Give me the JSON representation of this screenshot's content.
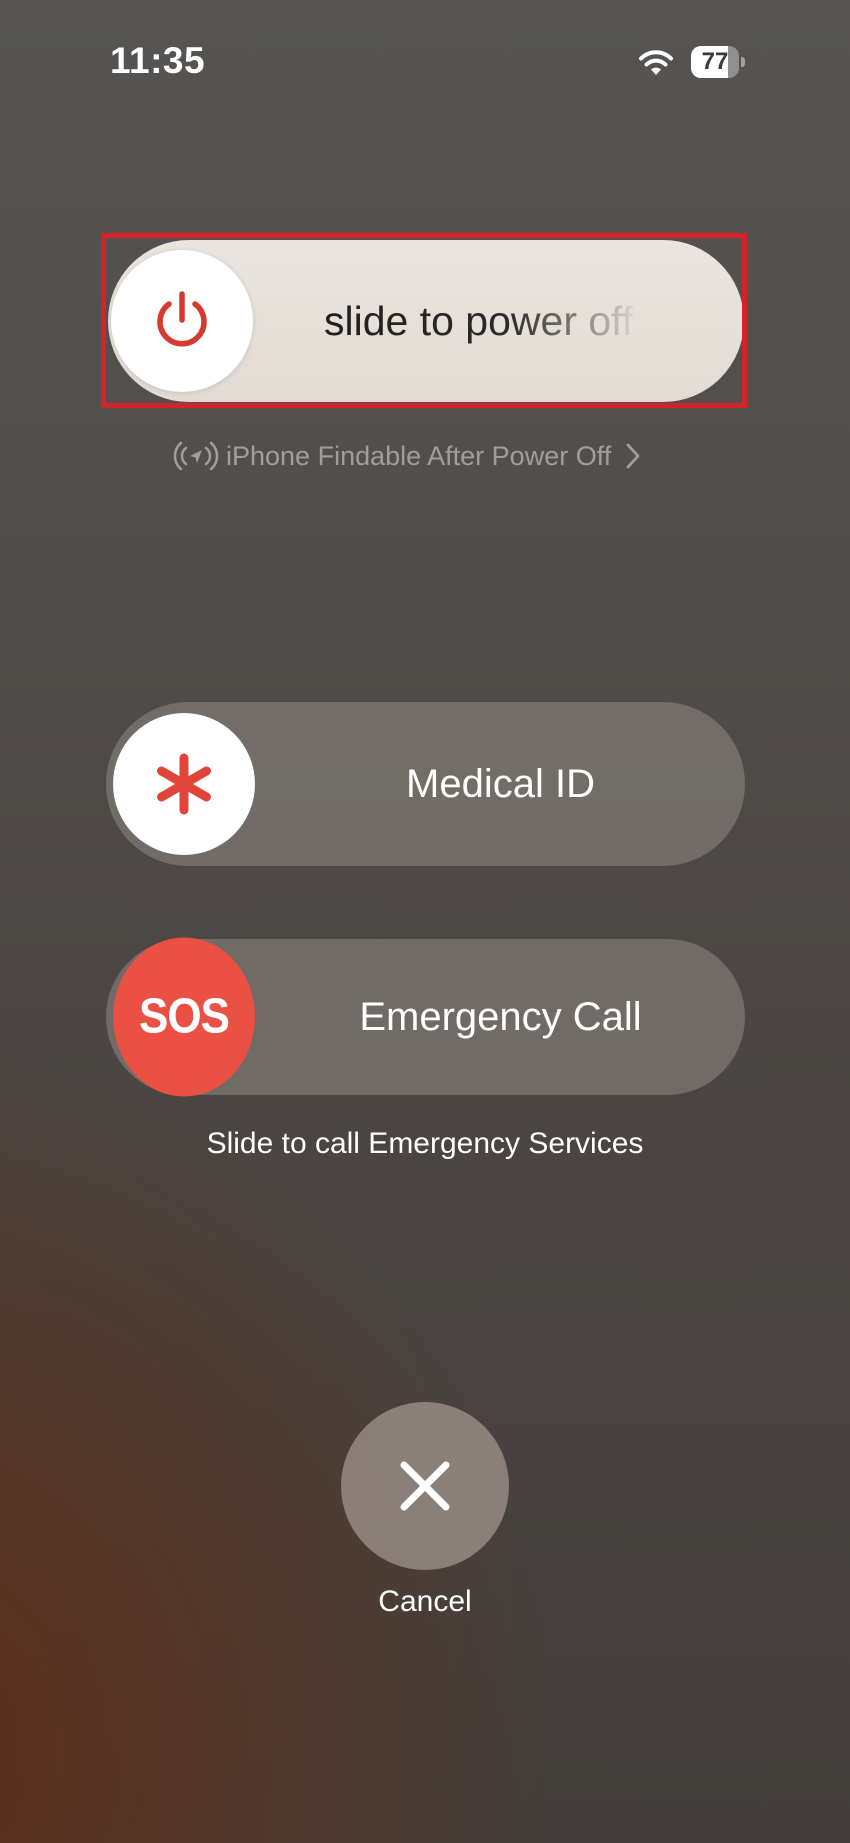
{
  "status_bar": {
    "time": "11:35",
    "battery_level": "77",
    "wifi_icon": "wifi-icon"
  },
  "power_slider": {
    "label": "slide to power off",
    "knob_icon": "power-icon",
    "highlighted": true,
    "highlight_color": "#d3222a",
    "icon_color": "#d6392f"
  },
  "findable": {
    "label": "iPhone Findable After Power Off",
    "icon": "find-my-location-icon",
    "chevron_icon": "chevron-right-icon"
  },
  "medical_id": {
    "label": "Medical ID",
    "knob_icon": "medical-asterisk-icon",
    "icon_color": "#e0453a"
  },
  "emergency_sos": {
    "label": "Emergency Call",
    "knob_text": "SOS",
    "knob_color": "#ea5144",
    "hint": "Slide to call Emergency Services"
  },
  "cancel": {
    "label": "Cancel",
    "icon": "close-icon"
  }
}
